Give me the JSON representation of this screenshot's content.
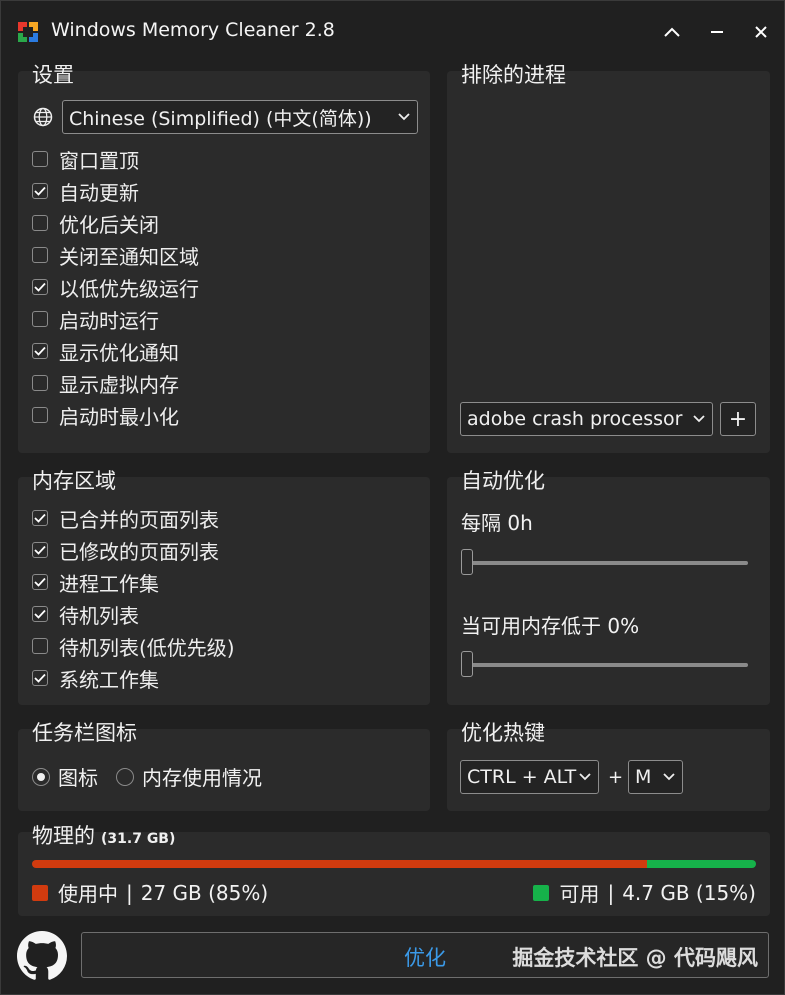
{
  "window": {
    "title": "Windows Memory Cleaner 2.8"
  },
  "settings": {
    "title": "设置",
    "language": "Chinese (Simplified) (中文(简体))",
    "options": [
      {
        "label": "窗口置顶",
        "checked": false
      },
      {
        "label": "自动更新",
        "checked": true
      },
      {
        "label": "优化后关闭",
        "checked": false
      },
      {
        "label": "关闭至通知区域",
        "checked": false
      },
      {
        "label": "以低优先级运行",
        "checked": true
      },
      {
        "label": "启动时运行",
        "checked": false
      },
      {
        "label": "显示优化通知",
        "checked": true
      },
      {
        "label": "显示虚拟内存",
        "checked": false
      },
      {
        "label": "启动时最小化",
        "checked": false
      }
    ]
  },
  "excluded": {
    "title": "排除的进程",
    "process": "adobe crash processor",
    "add_label": "+"
  },
  "memory_areas": {
    "title": "内存区域",
    "options": [
      {
        "label": "已合并的页面列表",
        "checked": true
      },
      {
        "label": "已修改的页面列表",
        "checked": true
      },
      {
        "label": "进程工作集",
        "checked": true
      },
      {
        "label": "待机列表",
        "checked": true
      },
      {
        "label": "待机列表(低优先级)",
        "checked": false
      },
      {
        "label": "系统工作集",
        "checked": true
      }
    ]
  },
  "auto_optimize": {
    "title": "自动优化",
    "interval_label": "每隔 0h",
    "interval_value": 0,
    "low_memory_label": "当可用内存低于 0%",
    "low_memory_value": 0
  },
  "tray_icon": {
    "title": "任务栏图标",
    "options": [
      {
        "label": "图标",
        "selected": true
      },
      {
        "label": "内存使用情况",
        "selected": false
      }
    ]
  },
  "hotkey": {
    "title": "优化热键",
    "modifier": "CTRL + ALT",
    "plus": "+",
    "key": "M"
  },
  "physical": {
    "title": "物理的",
    "total": "(31.7 GB)",
    "used_label": "使用中",
    "used_value": "27 GB (85%)",
    "free_label": "可用",
    "free_value": "4.7 GB (15%)",
    "separator": "|",
    "used_fraction": 0.85,
    "used_color": "#d13b0f",
    "free_color": "#16b24a"
  },
  "footer": {
    "optimize_label": "优化",
    "watermark": "掘金技术社区 @ 代码飓风",
    "github_icon": "github-icon"
  },
  "colors": {
    "accent": "#3b9ae8"
  }
}
